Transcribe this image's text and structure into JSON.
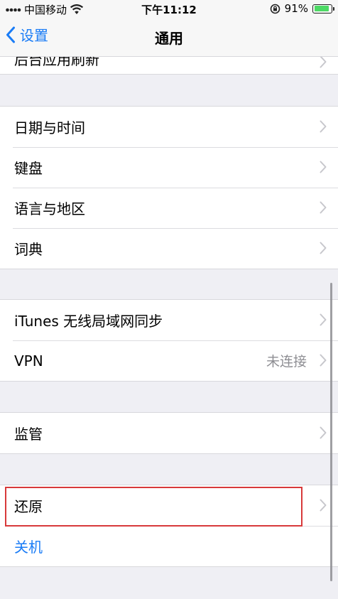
{
  "status_bar": {
    "carrier": "中国移动",
    "time": "下午11:12",
    "battery_percent": "91%",
    "battery_level": 0.91
  },
  "nav": {
    "back_label": "设置",
    "title": "通用"
  },
  "groups": [
    {
      "rows": [
        {
          "label": "后台应用刷新"
        }
      ]
    },
    {
      "rows": [
        {
          "label": "日期与时间"
        },
        {
          "label": "键盘"
        },
        {
          "label": "语言与地区"
        },
        {
          "label": "词典"
        }
      ]
    },
    {
      "rows": [
        {
          "label": "iTunes 无线局域网同步"
        },
        {
          "label": "VPN",
          "detail": "未连接"
        }
      ]
    },
    {
      "rows": [
        {
          "label": "监管"
        }
      ]
    },
    {
      "rows": [
        {
          "label": "还原"
        },
        {
          "label": "关机"
        }
      ]
    }
  ],
  "colors": {
    "accent": "#1a7cf6",
    "highlight": "#d8393a",
    "battery": "#4cd964",
    "background": "#efeff4"
  }
}
